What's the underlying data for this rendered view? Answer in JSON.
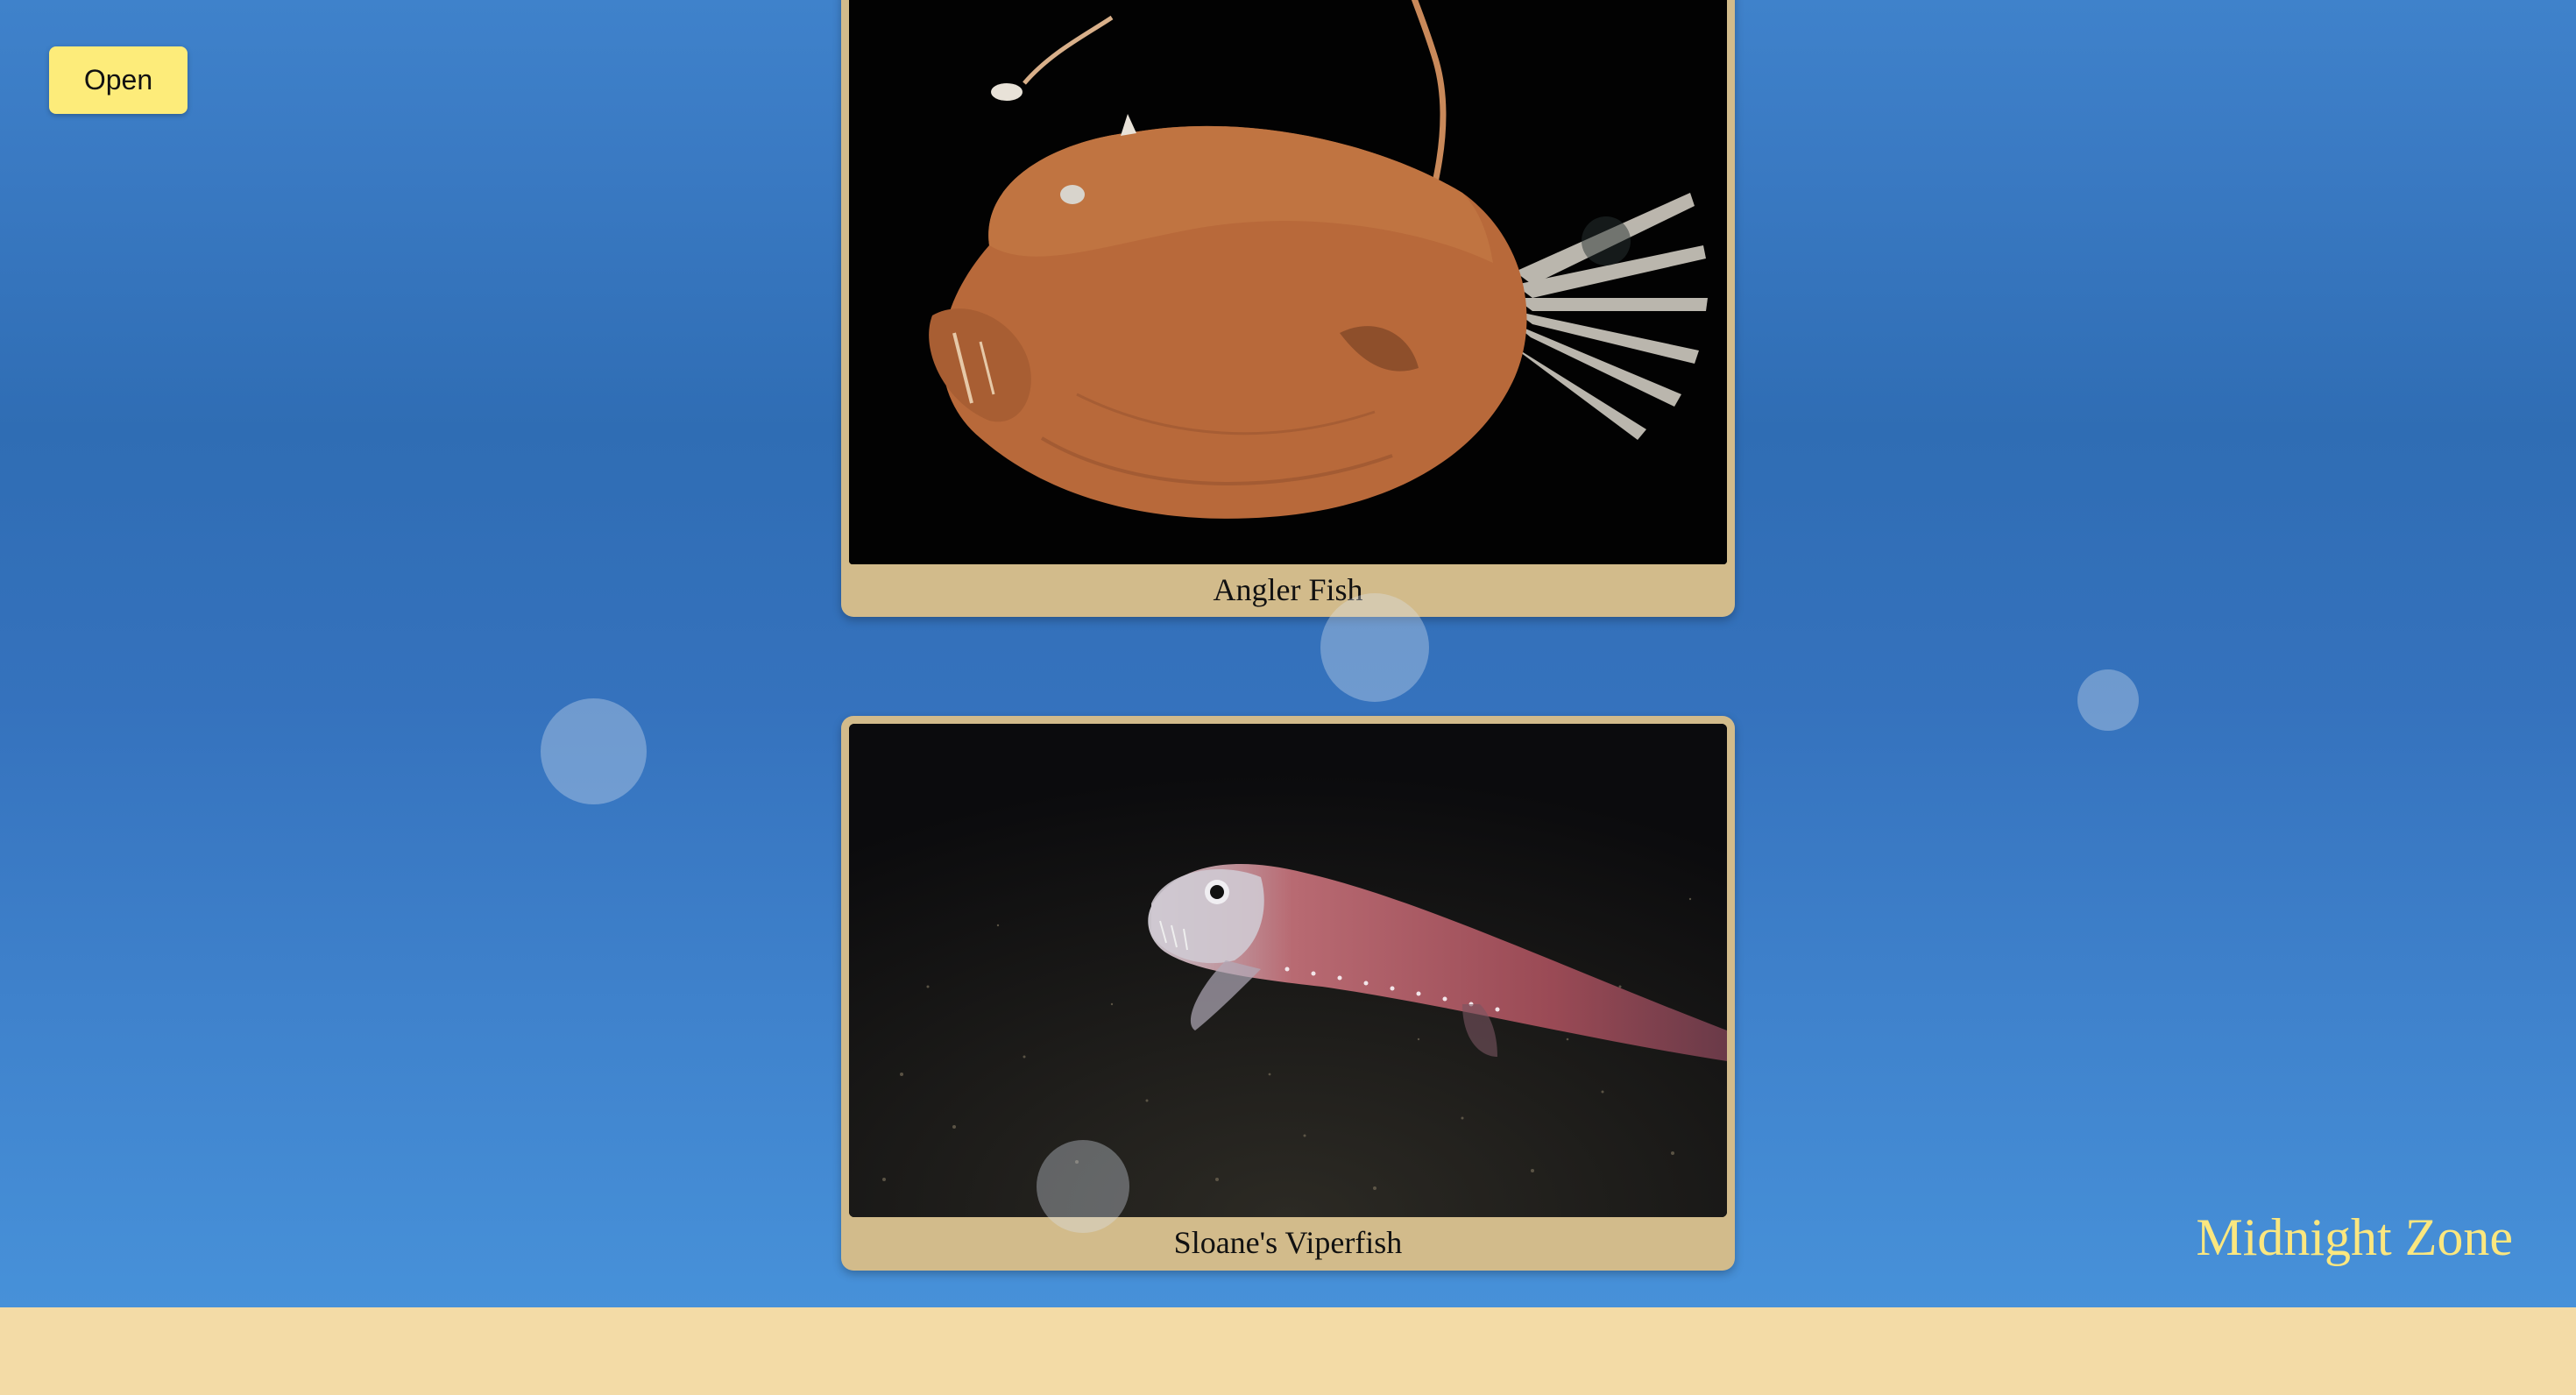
{
  "controls": {
    "open_label": "Open"
  },
  "cards": [
    {
      "caption": "Angler Fish",
      "image_subject": "angler-fish-photo"
    },
    {
      "caption": "Sloane's Viperfish",
      "image_subject": "viperfish-photo"
    }
  ],
  "zone": {
    "title": "Midnight Zone"
  },
  "colors": {
    "ocean_top": "#3f82cb",
    "ocean_bottom": "#4791d9",
    "sand": "#f3dba6",
    "card_frame": "#d2bb8b",
    "open_button": "#fdec7a",
    "zone_title": "#fbe77f"
  }
}
